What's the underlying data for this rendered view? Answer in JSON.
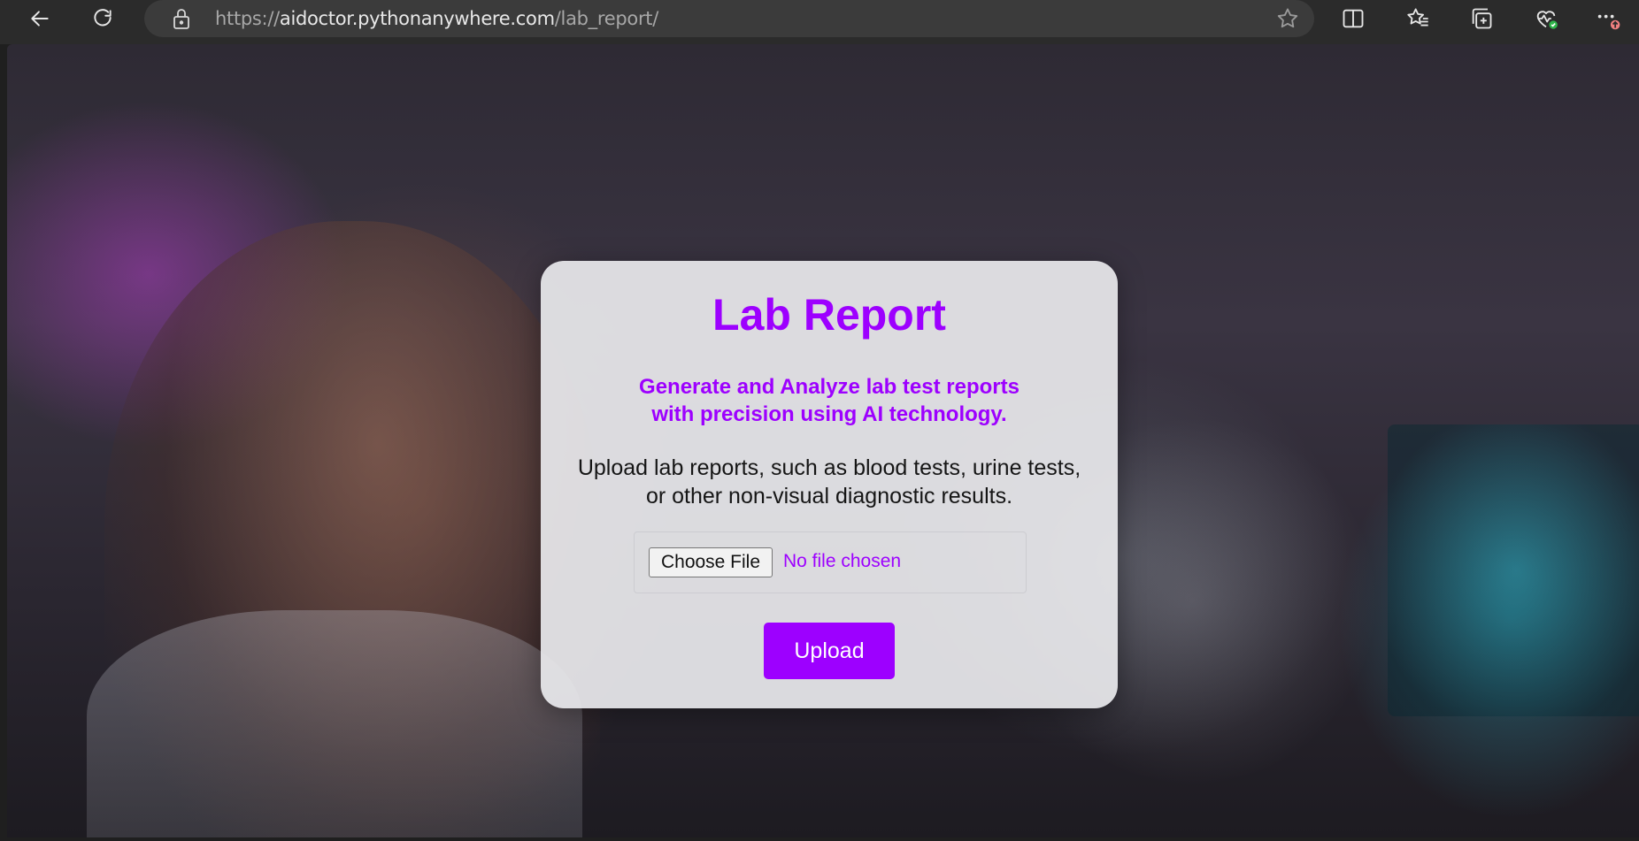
{
  "browser": {
    "url_prefix": "https://",
    "url_host": "aidoctor.pythonanywhere.com",
    "url_path": "/lab_report/",
    "icons": [
      "back-arrow-icon",
      "refresh-icon",
      "lock-icon",
      "star-icon",
      "split-screen-icon",
      "favorites-icon",
      "collections-icon",
      "browser-essentials-icon",
      "more-options-icon"
    ],
    "accent_color": "#9d00ff"
  },
  "card": {
    "title": "Lab Report",
    "subtitle_line1": "Generate and Analyze lab test reports",
    "subtitle_line2": "with precision using AI technology.",
    "desc_line1": "Upload lab reports, such as blood tests, urine tests,",
    "desc_line2": "or other non-visual diagnostic results.",
    "choose_file_label": "Choose File",
    "file_status": "No file chosen",
    "upload_label": "Upload"
  }
}
